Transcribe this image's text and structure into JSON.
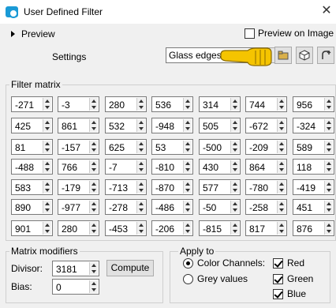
{
  "window": {
    "title": "User Defined Filter",
    "close_glyph": "✕"
  },
  "preview": {
    "toggle_label": "Preview",
    "checkbox_label": "Preview on Image",
    "checked": false
  },
  "settings": {
    "label": "Settings",
    "preset_value": "Glass edges"
  },
  "filter_matrix": {
    "title": "Filter matrix",
    "rows": [
      [
        "-271",
        "-3",
        "280",
        "536",
        "314",
        "744",
        "956"
      ],
      [
        "425",
        "861",
        "532",
        "-948",
        "505",
        "-672",
        "-324"
      ],
      [
        "81",
        "-157",
        "625",
        "53",
        "-500",
        "-209",
        "589"
      ],
      [
        "-488",
        "766",
        "-7",
        "-810",
        "430",
        "864",
        "118"
      ],
      [
        "583",
        "-179",
        "-713",
        "-870",
        "577",
        "-780",
        "-419"
      ],
      [
        "890",
        "-977",
        "-278",
        "-486",
        "-50",
        "-258",
        "451"
      ],
      [
        "901",
        "280",
        "-453",
        "-206",
        "-815",
        "817",
        "876"
      ]
    ]
  },
  "matrix_modifiers": {
    "title": "Matrix modifiers",
    "divisor_label": "Divisor:",
    "divisor_value": "3181",
    "bias_label": "Bias:",
    "bias_value": "0",
    "compute_label": "Compute"
  },
  "apply_to": {
    "title": "Apply to",
    "color_channels_label": "Color Channels:",
    "grey_values_label": "Grey values",
    "selected": "color_channels",
    "channels": [
      {
        "label": "Red",
        "checked": true
      },
      {
        "label": "Green",
        "checked": true
      },
      {
        "label": "Blue",
        "checked": true
      }
    ]
  }
}
